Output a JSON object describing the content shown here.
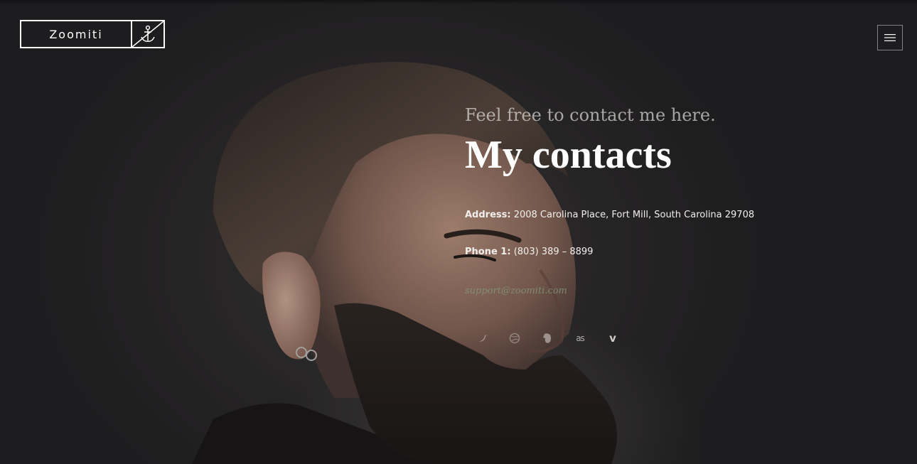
{
  "logo": {
    "text": "Zoomiti"
  },
  "header": {
    "menu_icon": "hamburger-icon"
  },
  "contact": {
    "subtitle": "Feel free to contact me here.",
    "title": "My contacts",
    "address_label": "Address:",
    "address_value": "2008 Carolina Place, Fort Mill, South Carolina 29708",
    "phone_label": "Phone 1:",
    "phone_value": "(803) 389 – 8899",
    "email": "support@zoomiti.com"
  },
  "social": {
    "icons": [
      "twitter-icon",
      "dribbble-icon",
      "evernote-icon",
      "lastfm-icon",
      "vimeo-icon"
    ],
    "vimeo_glyph": "v",
    "lastfm_glyph": "as"
  },
  "colors": {
    "text_primary": "#ffffff",
    "text_secondary": "#dcdad6",
    "email": "#829478",
    "background": "#2a2829"
  }
}
